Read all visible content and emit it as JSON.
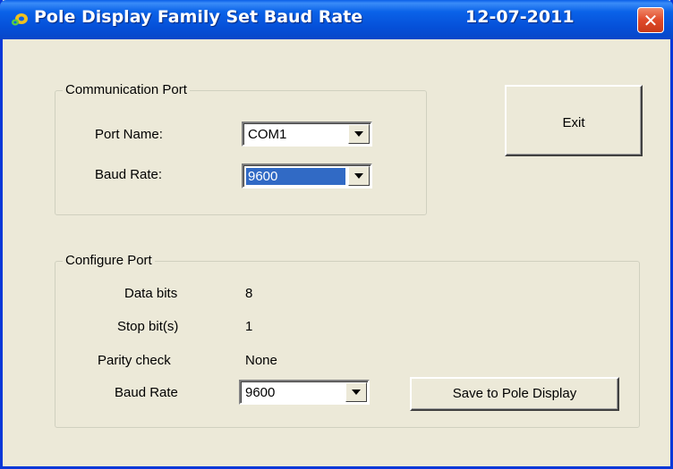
{
  "window": {
    "title": "Pole Display Family Set Baud Rate",
    "date": "12-07-2011",
    "close_glyph": "✕",
    "app_icon": "pole-display-logo"
  },
  "communication_port": {
    "group_label": "Communication Port",
    "port_name_label": "Port Name:",
    "port_name_value": "COM1",
    "baud_rate_label": "Baud Rate:",
    "baud_rate_value": "9600"
  },
  "exit_button": {
    "label": "Exit"
  },
  "configure_port": {
    "group_label": "Configure Port",
    "data_bits_label": "Data bits",
    "data_bits_value": "8",
    "stop_bits_label": "Stop bit(s)",
    "stop_bits_value": "1",
    "parity_label": "Parity check",
    "parity_value": "None",
    "baud_rate_label": "Baud Rate",
    "baud_rate_value": "9600",
    "save_button_label": "Save to Pole Display"
  },
  "colors": {
    "titlebar": "#0550d8",
    "window_bg": "#ece9d8",
    "selection": "#316ac5",
    "close_button": "#e04a2a"
  }
}
